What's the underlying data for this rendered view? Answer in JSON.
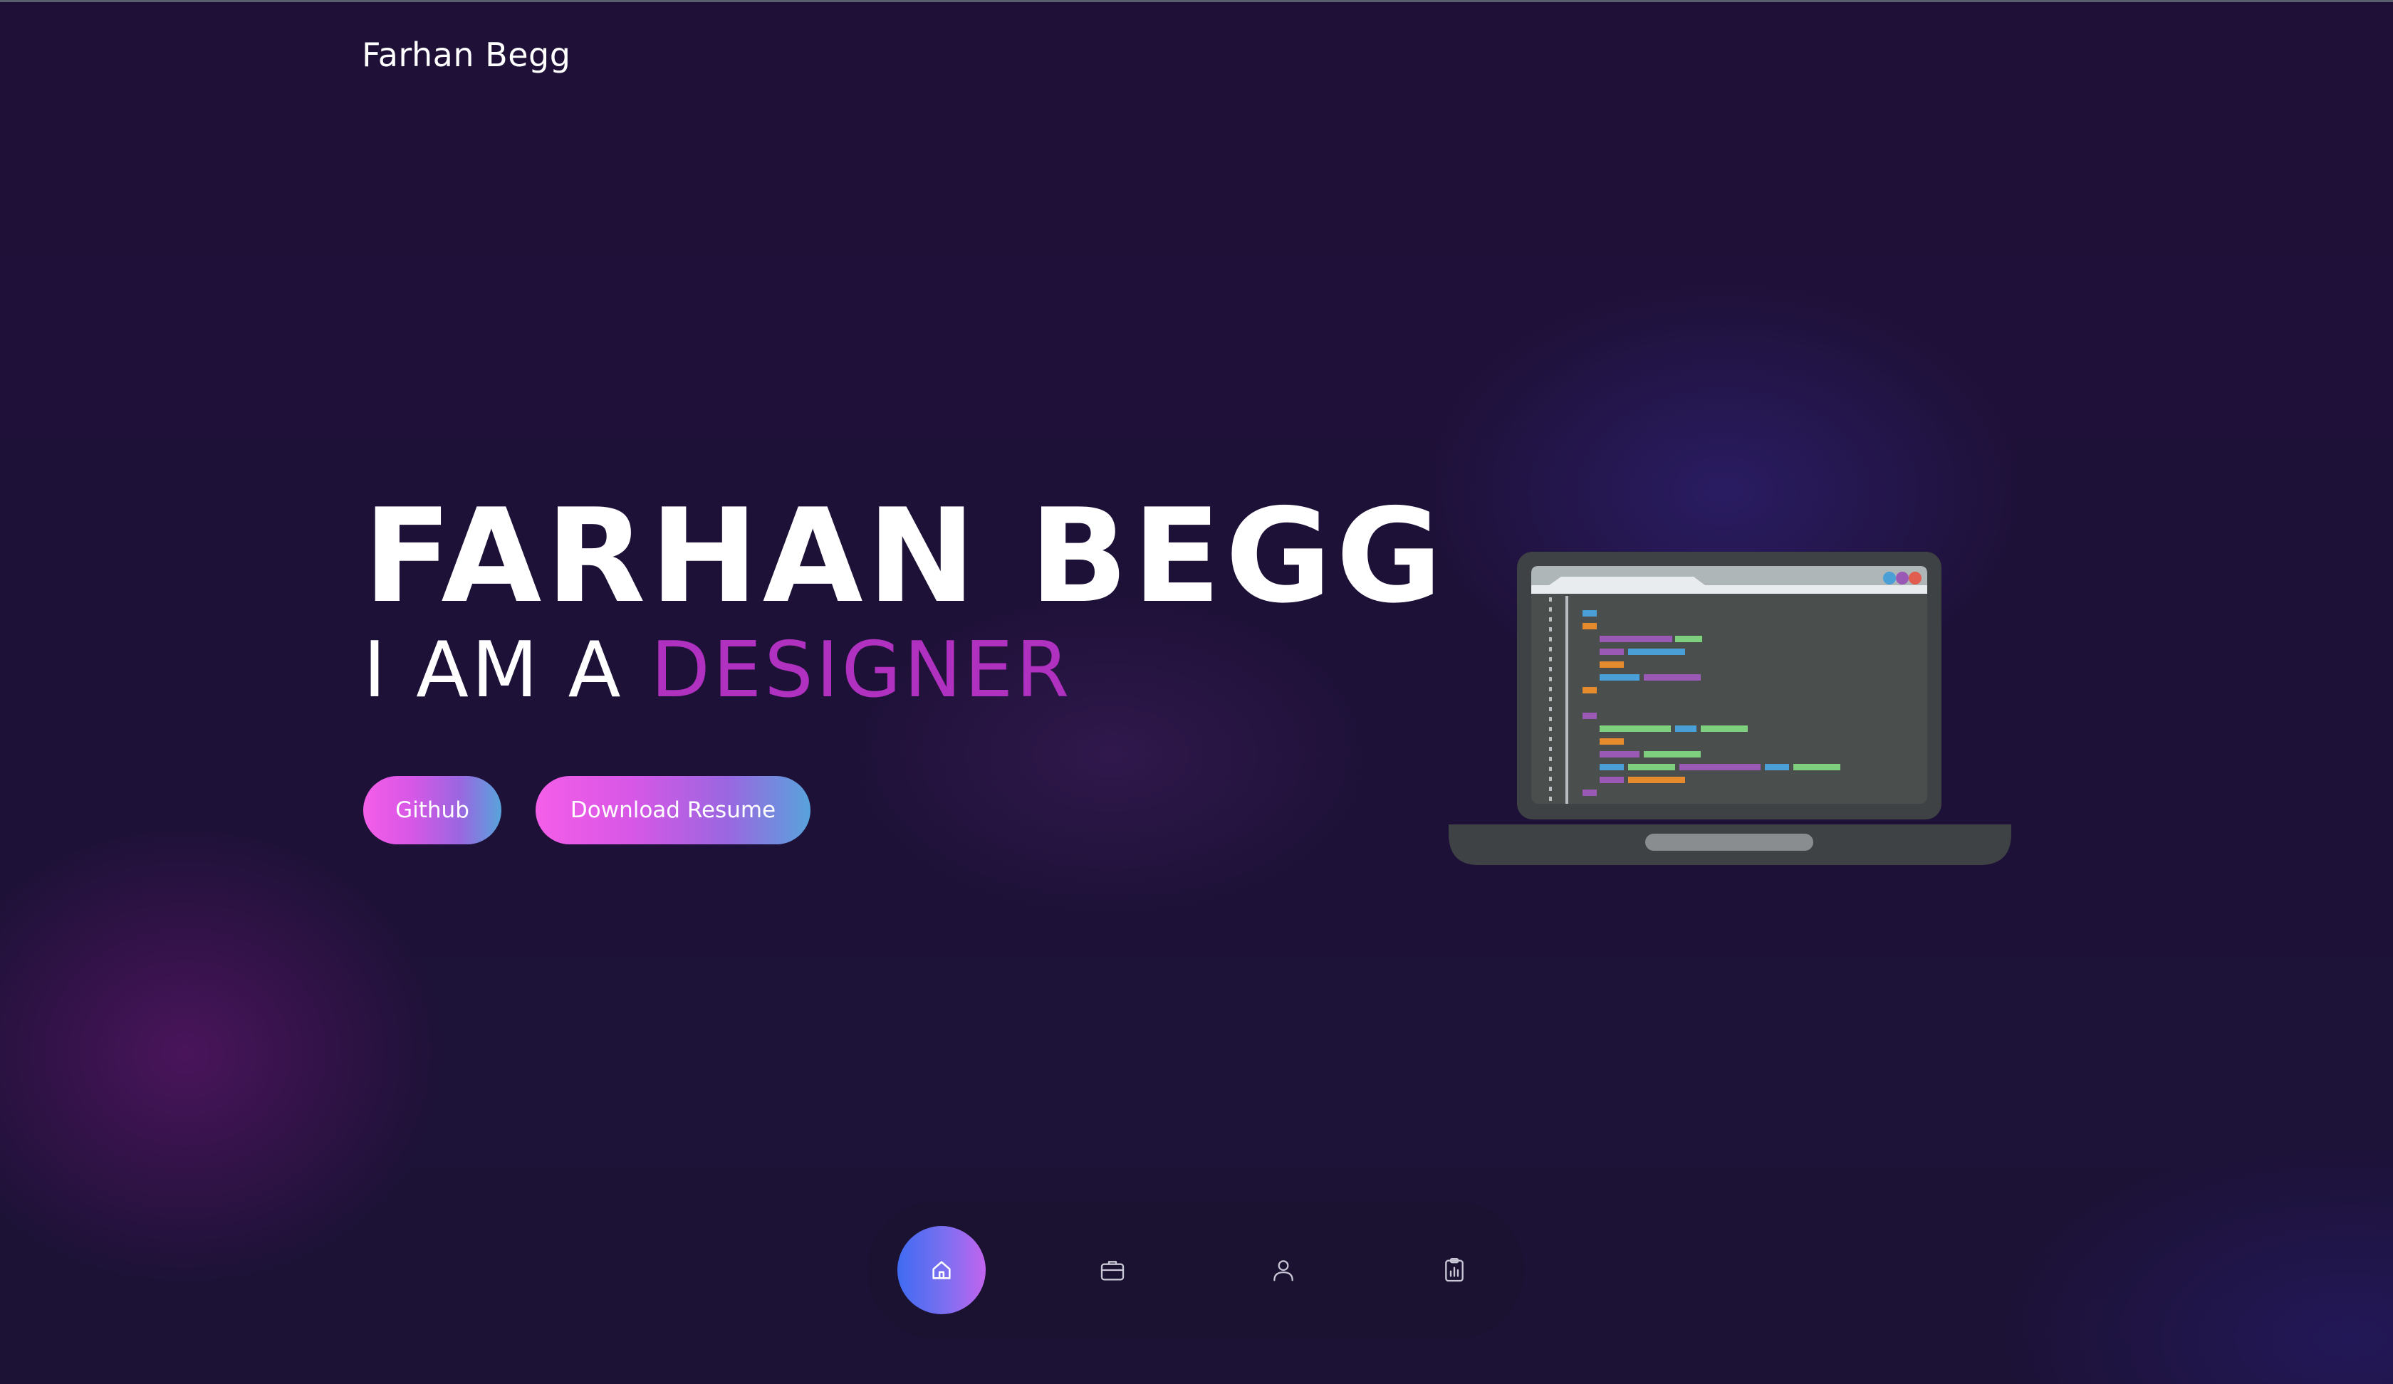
{
  "header": {
    "brand": "Farhan Begg"
  },
  "hero": {
    "name": "FARHAN BEGG",
    "role_prefix": "I AM A ",
    "role_highlight": "DESIGNER"
  },
  "actions": {
    "github_label": "Github",
    "resume_label": "Download Resume"
  },
  "dock": {
    "items": [
      {
        "icon": "home-icon",
        "active": true
      },
      {
        "icon": "briefcase-icon",
        "active": false
      },
      {
        "icon": "user-icon",
        "active": false
      },
      {
        "icon": "clipboard-chart-icon",
        "active": false
      }
    ]
  },
  "colors": {
    "background": "#1e1138",
    "accent_highlight": "#b030c0",
    "button_gradient_start": "#f45ee8",
    "button_gradient_end": "#58a3dc",
    "dock_active_start": "#3f6bf2",
    "dock_active_end": "#c264ee"
  }
}
